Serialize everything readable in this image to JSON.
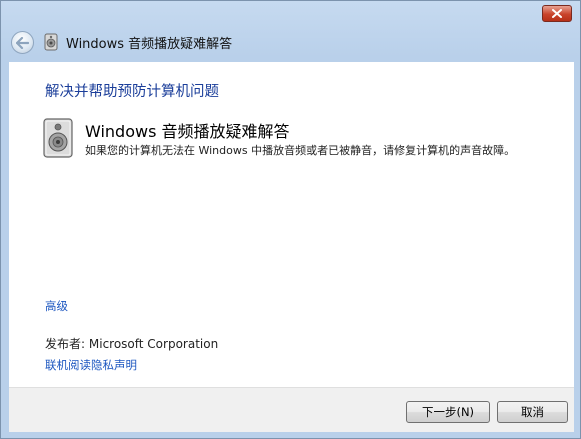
{
  "window": {
    "title": "Windows 音频播放疑难解答",
    "close_label": "✕"
  },
  "content": {
    "heading": "解决并帮助预防计算机问题",
    "item_title": "Windows 音频播放疑难解答",
    "item_description": "如果您的计算机无法在 Windows 中播放音频或者已被静音，请修复计算机的声音故障。",
    "advanced_link": "高级",
    "publisher_label": "发布者:",
    "publisher_name": "Microsoft Corporation",
    "privacy_link": "联机阅读隐私声明"
  },
  "footer": {
    "next_button": "下一步(N)",
    "cancel_button": "取消"
  },
  "icons": {
    "back": "back-arrow-icon",
    "title": "speaker-icon",
    "item": "speaker-icon",
    "close": "close-icon"
  }
}
